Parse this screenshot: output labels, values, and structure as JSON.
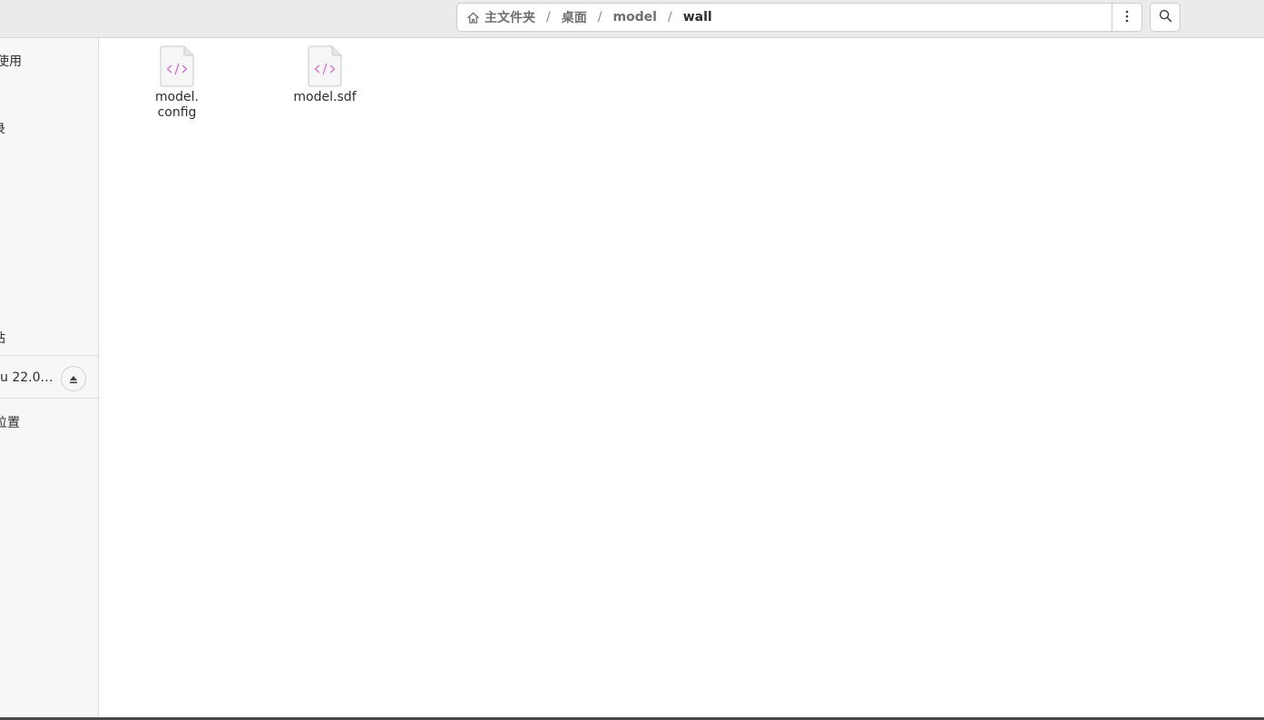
{
  "header": {
    "path": {
      "home_icon": "home-icon",
      "crumbs": [
        "主文件夹",
        "桌面",
        "model",
        "wall"
      ],
      "separator": "/"
    },
    "menu_icon": "vertical-dots-icon",
    "search_icon": "search-icon"
  },
  "sidebar": {
    "items": [
      {
        "label": "使用"
      },
      {
        "label": "录"
      },
      {
        "label": "站"
      },
      {
        "label": "u 22.0…"
      },
      {
        "label": "位置"
      }
    ],
    "eject_icon": "eject-icon"
  },
  "files": [
    {
      "name": "model.\nconfig",
      "icon": "code-file-icon"
    },
    {
      "name": "model.sdf",
      "icon": "code-file-icon"
    }
  ],
  "colors": {
    "header_bg": "#ebebeb",
    "sidebar_bg": "#f7f7f7",
    "code_icon": "#d06bd0"
  }
}
